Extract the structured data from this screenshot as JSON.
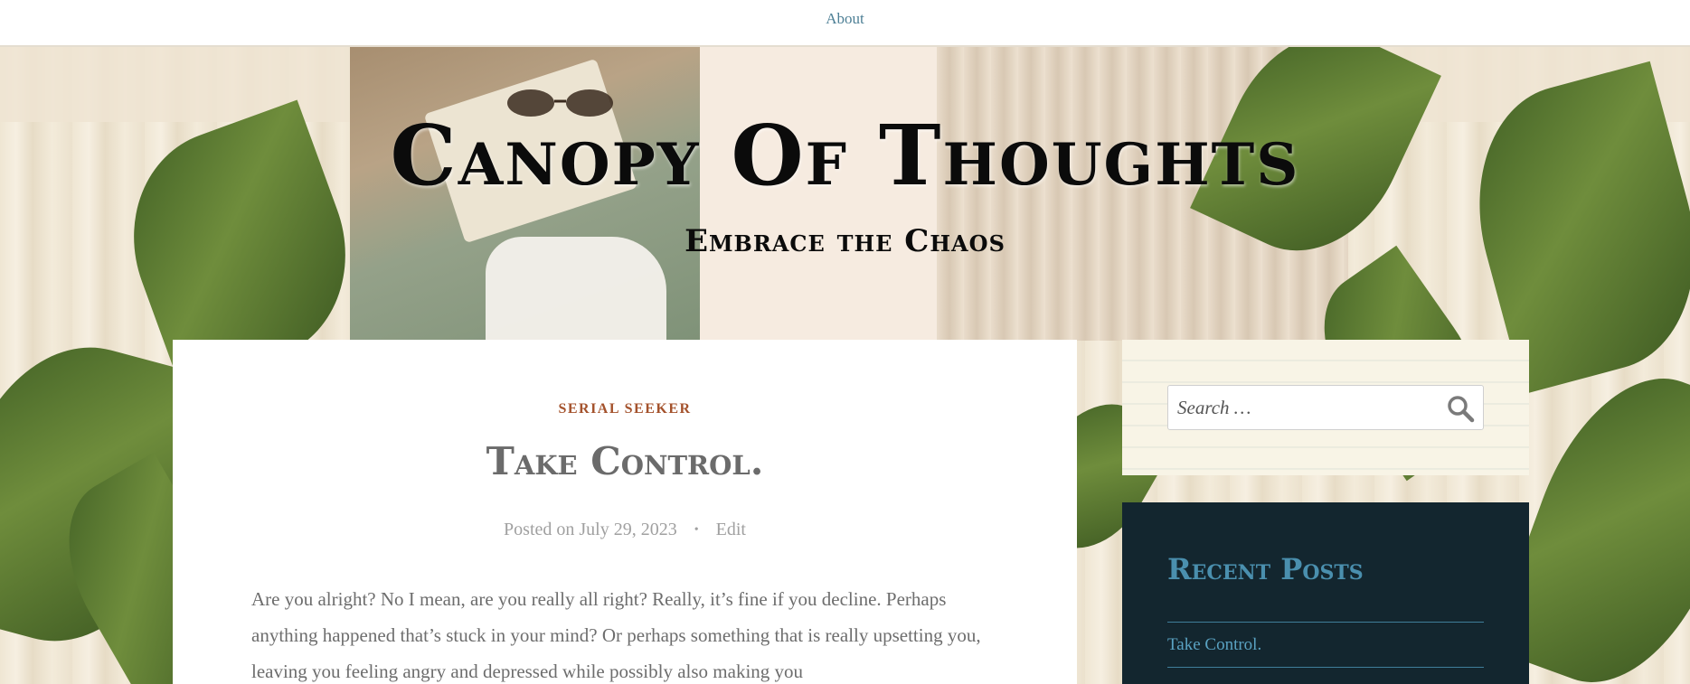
{
  "nav": {
    "about_label": "About"
  },
  "site": {
    "title": "Canopy Of Thoughts",
    "tagline": "Embrace the Chaos"
  },
  "post": {
    "category": "SERIAL SEEKER",
    "title": "Take Control.",
    "posted_prefix": "Posted on",
    "date": "July 29, 2023",
    "edit_label": "Edit",
    "body": "Are you alright? No I mean, are you really all right? Really, it’s fine if you decline. Perhaps anything happened that’s stuck in your mind? Or perhaps something that is really upsetting you, leaving you feeling angry and depressed while possibly also making you"
  },
  "sidebar": {
    "search": {
      "placeholder": "Search …",
      "icon": "search-icon"
    },
    "recent_posts": {
      "title": "Recent Posts",
      "items": [
        "Take Control."
      ]
    }
  },
  "colors": {
    "category": "#a4522c",
    "link": "#4d7f95",
    "widget_dark": "#13262f",
    "widget_heading": "#4a8fae"
  }
}
